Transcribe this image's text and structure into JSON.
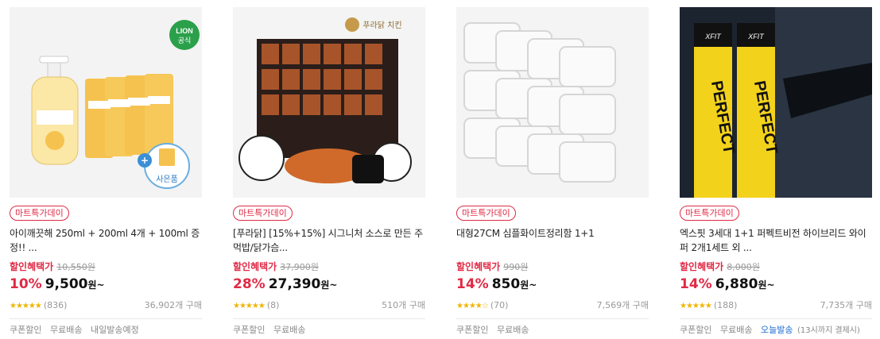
{
  "products": [
    {
      "badge": "마트특가데이",
      "title": "아이깨끗해 250ml + 200ml 4개 + 100ml 증정!! ...",
      "brand_logo": "LION 공식",
      "gift_label": "사은품",
      "price_label": "할인혜택가",
      "original_price": "10,550원",
      "discount_rate": "10%",
      "sale_price": "9,500",
      "won": "원~",
      "rating": 5,
      "review_count": "(836)",
      "purchase_count": "36,902개 구매",
      "tags": [
        "쿠폰할인",
        "무료배송",
        "내일발송예정"
      ]
    },
    {
      "badge": "마트특가데이",
      "title": "[푸라닭] [15%+15%] 시그니처 소스로 만든 주먹밥/닭가슴...",
      "brand_logo": "푸라닭 치킨",
      "price_label": "할인혜택가",
      "original_price": "37,900원",
      "discount_rate": "28%",
      "sale_price": "27,390",
      "won": "원~",
      "rating": 4.5,
      "review_count": "(8)",
      "purchase_count": "510개 구매",
      "tags": [
        "쿠폰할인",
        "무료배송"
      ]
    },
    {
      "badge": "마트특가데이",
      "title": "대형27CM 심플화이트정리함 1+1",
      "price_label": "할인혜택가",
      "original_price": "990원",
      "discount_rate": "14%",
      "sale_price": "850",
      "won": "원~",
      "rating": 4,
      "review_count": "(70)",
      "purchase_count": "7,569개 구매",
      "tags": [
        "쿠폰할인",
        "무료배송"
      ]
    },
    {
      "badge": "마트특가데이",
      "title": "엑스핏 3세대 1+1 퍼펙트비전 하이브리드 와이퍼 2개1세트 외 ...",
      "brand_logo": "XFIT",
      "box_text": "PERFECT VISION",
      "price_label": "할인혜택가",
      "original_price": "8,000원",
      "discount_rate": "14%",
      "sale_price": "6,880",
      "won": "원~",
      "rating": 4.5,
      "review_count": "(188)",
      "purchase_count": "7,735개 구매",
      "tags": [
        "쿠폰할인",
        "무료배송",
        "오늘발송"
      ],
      "tag_note": "(13시까지 결제시)"
    }
  ],
  "stars": {
    "full": "★★★★★",
    "four_half": "★★★★★",
    "four": "★★★★☆"
  }
}
